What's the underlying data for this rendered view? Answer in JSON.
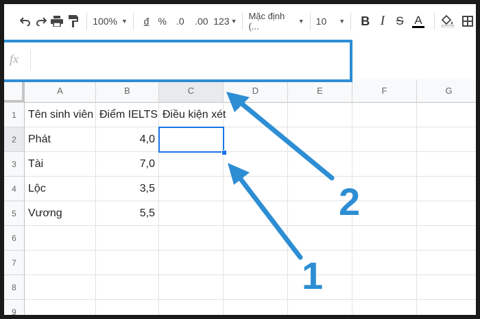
{
  "toolbar": {
    "zoom": "100%",
    "currency_symbol": "đ",
    "percent_symbol": "%",
    "decrease_decimal": ".0",
    "increase_decimal": ".00",
    "more_formats": "123",
    "font_name": "Mặc định (...",
    "font_size": "10",
    "bold": "B",
    "italic": "I",
    "strikethrough": "S",
    "text_color": "A"
  },
  "formula_bar": {
    "fx_label": "fx",
    "value": ""
  },
  "columns": [
    "A",
    "B",
    "C",
    "D",
    "E",
    "F",
    "G"
  ],
  "rows": [
    "1",
    "2",
    "3",
    "4",
    "5",
    "6",
    "7",
    "8",
    "9"
  ],
  "cells": {
    "A1": "Tên sinh viên",
    "B1": "Điểm IELTS",
    "C1": "Điều kiện xét",
    "A2": "Phát",
    "B2": "4,0",
    "A3": "Tài",
    "B3": "7,0",
    "A4": "Lộc",
    "B4": "3,5",
    "A5": "Vương",
    "B5": "5,5"
  },
  "selected_cell": "C2",
  "annotations": {
    "label_1": "1",
    "label_2": "2",
    "color": "#2d8ed4"
  },
  "colors": {
    "selection": "#1a73e8",
    "header_bg": "#f8f9fa"
  }
}
